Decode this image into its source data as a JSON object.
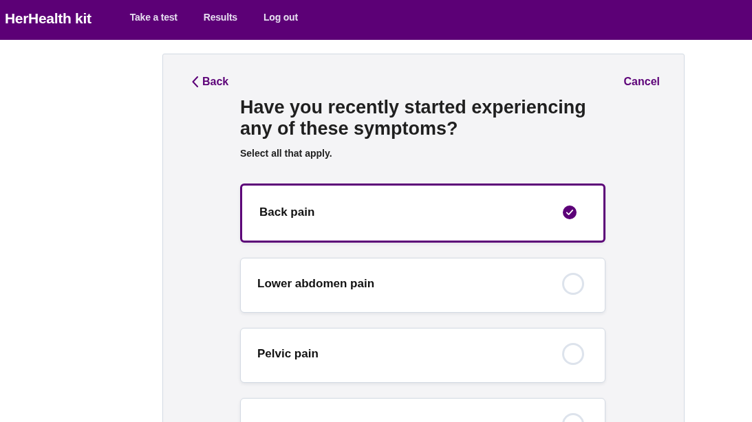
{
  "header": {
    "logo": "HerHealth kit",
    "nav": [
      {
        "label": "Take a test"
      },
      {
        "label": "Results"
      },
      {
        "label": "Log out"
      }
    ]
  },
  "panel": {
    "back": "Back",
    "cancel": "Cancel",
    "question": "Have you recently started experiencing any of these symptoms?",
    "instruction": "Select all that apply.",
    "options": [
      {
        "label": "Back pain",
        "checked": true
      },
      {
        "label": "Lower abdomen pain",
        "checked": false
      },
      {
        "label": "Pelvic pain",
        "checked": false
      },
      {
        "checked": false
      }
    ]
  }
}
